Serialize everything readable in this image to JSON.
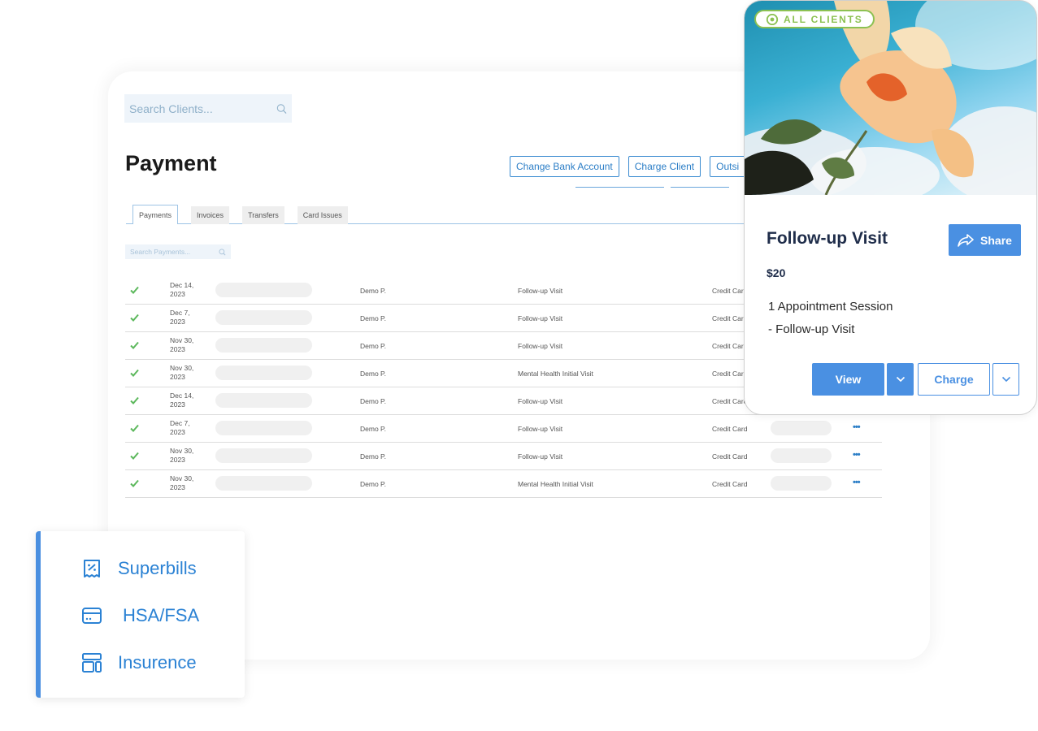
{
  "search_clients": {
    "placeholder": "Search Clients..."
  },
  "page": {
    "title": "Payment"
  },
  "top_buttons": [
    "Change Bank Account",
    "Charge Client",
    "Outsi"
  ],
  "tabs": [
    {
      "label": "Payments",
      "active": true
    },
    {
      "label": "Invoices",
      "active": false
    },
    {
      "label": "Transfers",
      "active": false
    },
    {
      "label": "Card Issues",
      "active": false
    }
  ],
  "search_payments": {
    "placeholder": "Search Payments..."
  },
  "payments": [
    {
      "date_line1": "Dec 14,",
      "date_line2": "2023",
      "client": "Demo P.",
      "service": "Follow-up Visit",
      "method": "Credit Card"
    },
    {
      "date_line1": "Dec 7,",
      "date_line2": "2023",
      "client": "Demo P.",
      "service": "Follow-up Visit",
      "method": "Credit Card"
    },
    {
      "date_line1": "Nov 30,",
      "date_line2": "2023",
      "client": "Demo P.",
      "service": "Follow-up Visit",
      "method": "Credit Card"
    },
    {
      "date_line1": "Nov 30,",
      "date_line2": "2023",
      "client": "Demo P.",
      "service": "Mental Health Initial Visit",
      "method": "Credit Card"
    },
    {
      "date_line1": "Dec 14,",
      "date_line2": "2023",
      "client": "Demo P.",
      "service": "Follow-up Visit",
      "method": "Credit Card"
    },
    {
      "date_line1": "Dec 7,",
      "date_line2": "2023",
      "client": "Demo P.",
      "service": "Follow-up Visit",
      "method": "Credit Card"
    },
    {
      "date_line1": "Nov 30,",
      "date_line2": "2023",
      "client": "Demo P.",
      "service": "Follow-up Visit",
      "method": "Credit Card"
    },
    {
      "date_line1": "Nov 30,",
      "date_line2": "2023",
      "client": "Demo P.",
      "service": "Mental Health Initial Visit",
      "method": "Credit Card"
    }
  ],
  "row_more_label": "•••",
  "side_menu": [
    {
      "label": "Superbills",
      "icon": "receipt-percent-icon"
    },
    {
      "label": "HSA/FSA",
      "icon": "credit-card-icon"
    },
    {
      "label": "Insurence",
      "icon": "layout-icon"
    }
  ],
  "offer": {
    "badge": "ALL CLIENTS",
    "title": "Follow-up Visit",
    "share_label": "Share",
    "price": "$20",
    "desc_line1": "1 Appointment Session",
    "desc_line2": "- Follow-up Visit",
    "view_label": "View",
    "charge_label": "Charge"
  },
  "colors": {
    "accent": "#4a90e2",
    "link_blue": "#2a7dc6",
    "success_green": "#5cb85c",
    "badge_green": "#8cc152",
    "title_navy": "#1f2d4a"
  }
}
